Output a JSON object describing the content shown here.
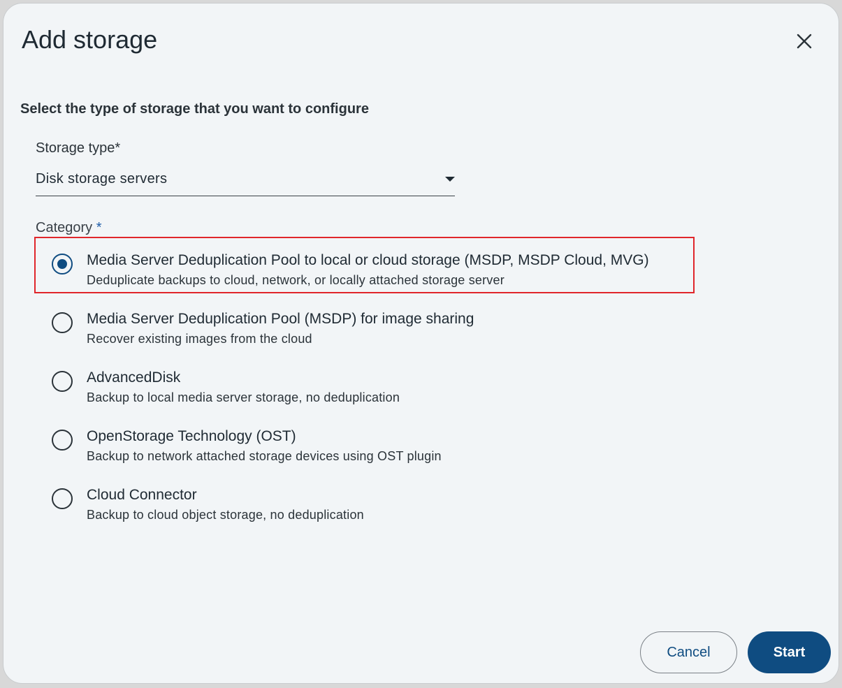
{
  "dialog": {
    "title": "Add storage",
    "close_icon": "close-icon",
    "section_heading": "Select the type of storage that you want to configure"
  },
  "storage_type": {
    "label": "Storage type*",
    "value": "Disk storage servers"
  },
  "category": {
    "label": "Category ",
    "required_marker": "*",
    "options": [
      {
        "title": "Media Server Deduplication Pool to local or cloud storage (MSDP, MSDP Cloud, MVG)",
        "description": "Deduplicate backups to cloud, network, or locally attached storage server",
        "selected": true
      },
      {
        "title": "Media Server Deduplication Pool (MSDP) for image sharing",
        "description": "Recover existing images from the cloud",
        "selected": false
      },
      {
        "title": "AdvancedDisk",
        "description": "Backup to local media server storage, no deduplication",
        "selected": false
      },
      {
        "title": "OpenStorage Technology (OST)",
        "description": "Backup to network attached storage devices using OST plugin",
        "selected": false
      },
      {
        "title": "Cloud Connector",
        "description": "Backup to cloud object storage, no deduplication",
        "selected": false
      }
    ]
  },
  "footer": {
    "cancel_label": "Cancel",
    "start_label": "Start"
  },
  "colors": {
    "primary": "#0f4c81",
    "highlight_border": "#e0262b",
    "dialog_background": "#f2f5f7"
  }
}
